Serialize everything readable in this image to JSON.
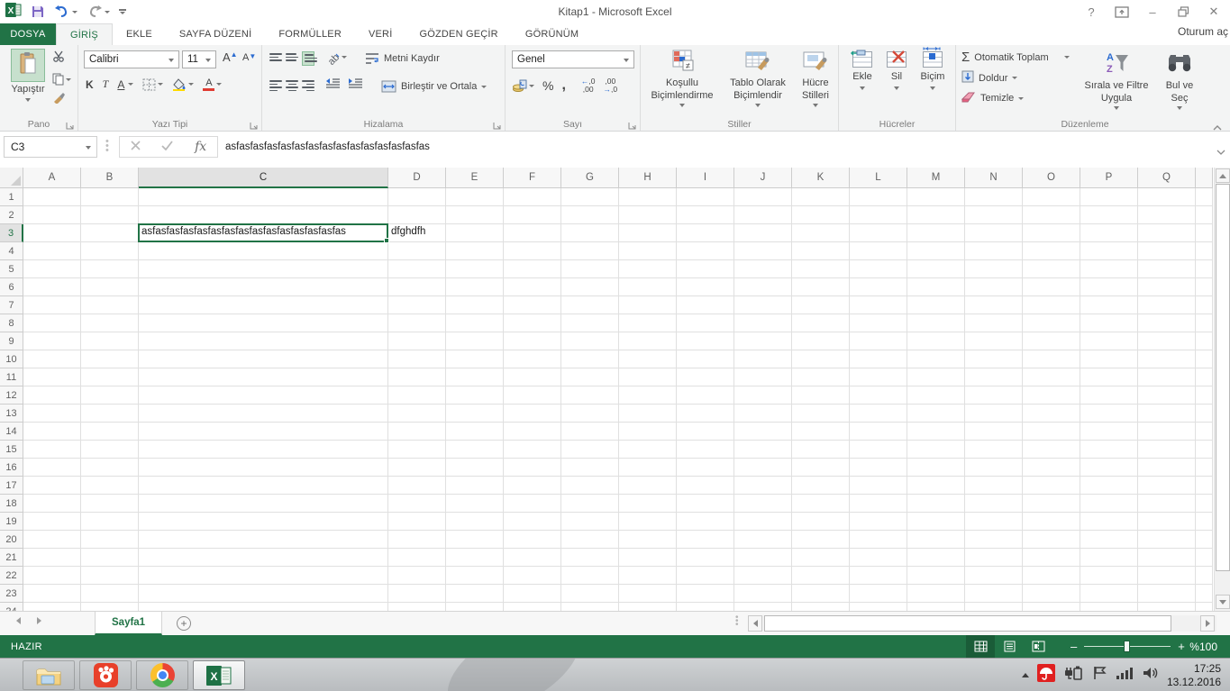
{
  "window": {
    "title": "Kitap1 - Microsoft Excel",
    "sign_in": "Oturum aç",
    "controls": {
      "help": "?",
      "minimize": "–",
      "close": "✕"
    }
  },
  "tabs": {
    "file": "DOSYA",
    "items": [
      "GİRİŞ",
      "EKLE",
      "SAYFA DÜZENİ",
      "FORMÜLLER",
      "VERİ",
      "GÖZDEN GEÇİR",
      "GÖRÜNÜM"
    ],
    "active": "GİRİŞ"
  },
  "ribbon": {
    "pano": {
      "label": "Pano",
      "paste": "Yapıştır"
    },
    "font": {
      "label": "Yazı Tipi",
      "name": "Calibri",
      "size": "11",
      "bold": "K",
      "italic": "T",
      "underline": "A",
      "grow": "A",
      "shrink": "A"
    },
    "alignment": {
      "label": "Hizalama",
      "wrap": "Metni Kaydır",
      "merge": "Birleştir ve Ortala"
    },
    "number": {
      "label": "Sayı",
      "format": "Genel",
      "percent": "%",
      "comma": ",",
      "inc_dec": "←,0 ,00",
      "dec_dec": ",00 →,0"
    },
    "styles": {
      "label": "Stiller",
      "conditional": "Koşullu Biçimlendirme",
      "as_table": "Tablo Olarak Biçimlendir",
      "cell_styles": "Hücre Stilleri",
      "neq": "≠"
    },
    "cells": {
      "label": "Hücreler",
      "insert": "Ekle",
      "delete": "Sil",
      "format": "Biçim"
    },
    "editing": {
      "label": "Düzenleme",
      "autosum": "Otomatik Toplam",
      "sigma": "Σ",
      "fill": "Doldur",
      "clear": "Temizle",
      "sort": "Sırala ve Filtre Uygula",
      "find": "Bul ve Seç",
      "az_a": "A",
      "az_z": "Z"
    }
  },
  "formula_bar": {
    "name_box": "C3",
    "fx": "fx",
    "value": "asfasfasfasfasfasfasfasfasfasfasfasfasfasfas"
  },
  "grid": {
    "columns": [
      "A",
      "B",
      "C",
      "D",
      "E",
      "F",
      "G",
      "H",
      "I",
      "J",
      "K",
      "L",
      "M",
      "N",
      "O",
      "P",
      "Q"
    ],
    "row_count": 24,
    "selected_column": "C",
    "selected_row": 3,
    "cells": [
      {
        "col": "C",
        "row": 3,
        "text": "asfasfasfasfasfasfasfasfasfasfasfasfasfasfas"
      },
      {
        "col": "D",
        "row": 3,
        "text": "dfghdfh"
      }
    ]
  },
  "sheet_bar": {
    "sheet": "Sayfa1",
    "add": "+"
  },
  "status_bar": {
    "ready": "HAZIR",
    "zoom_pct": "%100",
    "minus": "–",
    "plus": "+"
  },
  "taskbar": {
    "time": "17:25",
    "date": "13.12.2016"
  }
}
